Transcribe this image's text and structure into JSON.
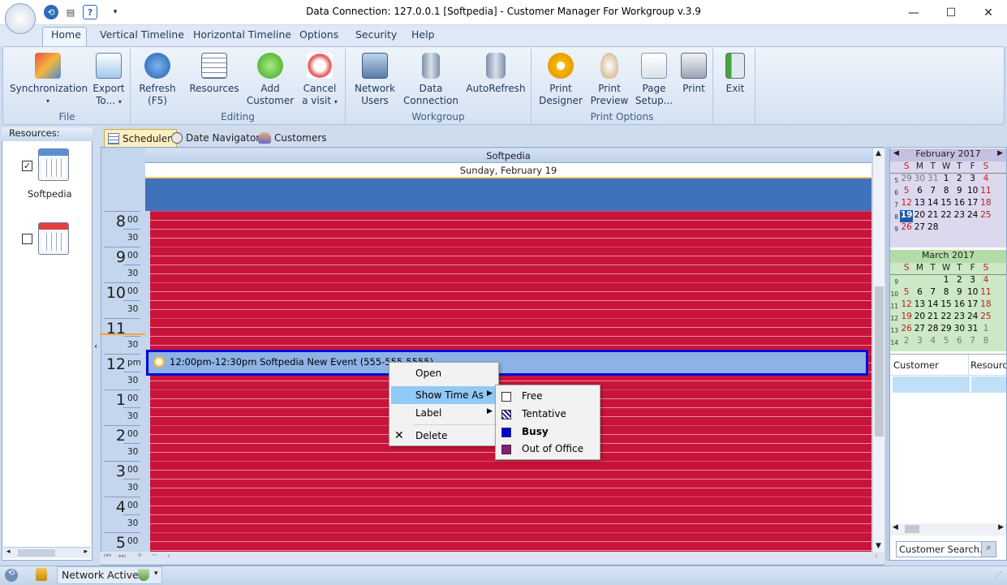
{
  "window": {
    "title": "Data Connection: 127.0.0.1 [Softpedia] - Customer Manager For Workgroup v.3.9"
  },
  "ribbon_tabs": [
    "Home",
    "Vertical Timeline",
    "Horizontal Timeline",
    "Options",
    "Security",
    "Help"
  ],
  "groups": {
    "file": "File",
    "editing": "Editing",
    "workgroup": "Workgroup",
    "print_options": "Print Options"
  },
  "buttons": {
    "sync": [
      "Synchronization",
      ""
    ],
    "export": [
      "Export",
      "To..."
    ],
    "refresh": [
      "Refresh",
      "(F5)"
    ],
    "resources": [
      "Resources",
      ""
    ],
    "add_customer": [
      "Add",
      "Customer"
    ],
    "cancel_visit": [
      "Cancel",
      "a visit"
    ],
    "network_users": [
      "Network",
      "Users"
    ],
    "data_connection": [
      "Data",
      "Connection"
    ],
    "autorefresh": [
      "AutoRefresh",
      ""
    ],
    "print_designer": [
      "Print",
      "Designer"
    ],
    "print_preview": [
      "Print",
      "Preview"
    ],
    "page_setup": [
      "Page",
      "Setup..."
    ],
    "print": [
      "Print",
      ""
    ],
    "exit": [
      "Exit",
      ""
    ]
  },
  "resources_panel": {
    "header": "Resources:",
    "items": [
      {
        "name": "Softpedia",
        "checked": true
      },
      {
        "name": "",
        "checked": false
      }
    ]
  },
  "content_tabs": [
    "Scheduler",
    "Date Navigator",
    "Customers"
  ],
  "scheduler": {
    "resource": "Softpedia",
    "date": "Sunday, February 19",
    "hours": [
      {
        "h": "8",
        "m": "00"
      },
      {
        "h": "9",
        "m": "00"
      },
      {
        "h": "10",
        "m": "00"
      },
      {
        "h": "11",
        "m": ""
      },
      {
        "h": "12",
        "m": "pm"
      },
      {
        "h": "1",
        "m": "00"
      },
      {
        "h": "2",
        "m": "00"
      },
      {
        "h": "3",
        "m": "00"
      },
      {
        "h": "4",
        "m": "00"
      },
      {
        "h": "5",
        "m": "00"
      }
    ],
    "half": "30",
    "event": "12:00pm-12:30pm Softpedia New Event (555-555-5555)"
  },
  "context_menu": {
    "items": [
      "Open",
      "Show Time As",
      "Label",
      "Delete"
    ],
    "submenu": [
      {
        "label": "Free",
        "color": "#ffffff"
      },
      {
        "label": "Tentative",
        "color": "hatch"
      },
      {
        "label": "Busy",
        "color": "#0000e0"
      },
      {
        "label": "Out of Office",
        "color": "#8a1a7a"
      }
    ]
  },
  "calendar_feb": {
    "title": "February 2017",
    "dow": [
      "S",
      "M",
      "T",
      "W",
      "T",
      "F",
      "S"
    ],
    "weeks": [
      {
        "wk": "5",
        "days": [
          "29",
          "30",
          "31",
          "1",
          "2",
          "3",
          "4"
        ]
      },
      {
        "wk": "6",
        "days": [
          "5",
          "6",
          "7",
          "8",
          "9",
          "10",
          "11"
        ]
      },
      {
        "wk": "7",
        "days": [
          "12",
          "13",
          "14",
          "15",
          "16",
          "17",
          "18"
        ]
      },
      {
        "wk": "8",
        "days": [
          "19",
          "20",
          "21",
          "22",
          "23",
          "24",
          "25"
        ]
      },
      {
        "wk": "9",
        "days": [
          "26",
          "27",
          "28",
          "",
          "",
          "",
          ""
        ]
      }
    ]
  },
  "calendar_mar": {
    "title": "March 2017",
    "dow": [
      "S",
      "M",
      "T",
      "W",
      "T",
      "F",
      "S"
    ],
    "weeks": [
      {
        "wk": "9",
        "days": [
          "",
          "",
          "",
          "1",
          "2",
          "3",
          "4"
        ]
      },
      {
        "wk": "10",
        "days": [
          "5",
          "6",
          "7",
          "8",
          "9",
          "10",
          "11"
        ]
      },
      {
        "wk": "11",
        "days": [
          "12",
          "13",
          "14",
          "15",
          "16",
          "17",
          "18"
        ]
      },
      {
        "wk": "12",
        "days": [
          "19",
          "20",
          "21",
          "22",
          "23",
          "24",
          "25"
        ]
      },
      {
        "wk": "13",
        "days": [
          "26",
          "27",
          "28",
          "29",
          "30",
          "31",
          "1"
        ]
      },
      {
        "wk": "14",
        "days": [
          "2",
          "3",
          "4",
          "5",
          "6",
          "7",
          "8"
        ]
      }
    ]
  },
  "customer_grid": {
    "columns": [
      "Customer",
      "Resource"
    ]
  },
  "customer_search": "Customer Search...",
  "status": {
    "network": "Network Active"
  }
}
